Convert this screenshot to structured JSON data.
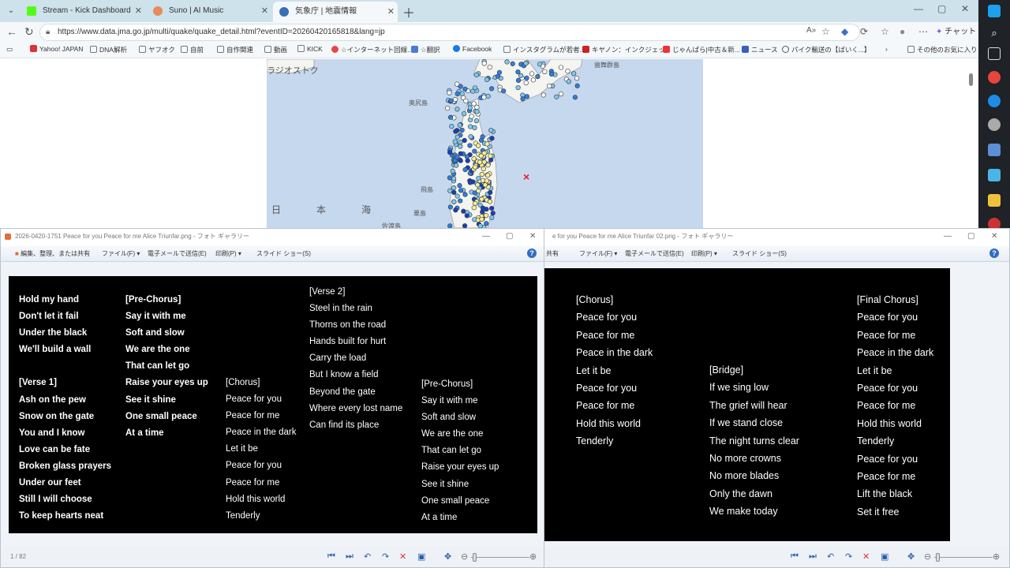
{
  "browser": {
    "tabs": [
      {
        "title": "Stream - Kick Dashboard",
        "color": "#53fc18"
      },
      {
        "title": "Suno | AI Music",
        "color": "#e88a5a"
      },
      {
        "title": "気象庁 | 地震情報",
        "color": "#3a6fb5"
      }
    ],
    "url": "https://www.data.jma.go.jp/multi/quake/quake_detail.html?eventID=20260420165818&lang=jp",
    "copilot_label": "チャット",
    "bookmarks": [
      "Yahoo! JAPAN",
      "DNA解析",
      "ヤフオク",
      "自前",
      "自作関連",
      "動画",
      "KICK",
      "☆インターネット回線...",
      "☆翻訳",
      "Facebook",
      "インスタグラムが若者...",
      "キヤノン：インクジェッ...",
      "じゃんぱら|中古＆新...",
      "ニュース",
      "パイク輸送の【ばいく...】"
    ],
    "other_favorites": "その他のお気に入り"
  },
  "map": {
    "labels": [
      "ラジオストク",
      "奥尻島",
      "飛島",
      "粟島",
      "佐渡島",
      "歯舞群島",
      "日",
      "本",
      "海"
    ],
    "epicenter_marker": "×"
  },
  "gallery_left": {
    "title": "2026-0420-1751 Peace for you Peace for me Alice Triunfar.png - フォト ギャラリー",
    "menu": [
      "編集、整理、または共有",
      "ファイル(F) ▾",
      "電子メールで送信(E)",
      "印刷(P) ▾",
      "スライド ショー(S)"
    ],
    "page_indicator": "1 / 82",
    "lyrics_col1": [
      "Hold my hand",
      "Don't let it fail",
      "Under the black",
      "We'll build a wall",
      "",
      "[Verse 1]",
      "Ash on the pew",
      "Snow on the gate",
      "You and I know",
      "Love can be fate",
      "Broken glass prayers",
      "Under our feet",
      "Still I will choose",
      "To keep hearts neat"
    ],
    "lyrics_col2": [
      "[Pre-Chorus]",
      "Say it with me",
      "Soft and slow",
      "We are the one",
      "That can let go",
      "Raise your eyes up",
      "See it shine",
      "One small peace",
      "At a time"
    ],
    "lyrics_col3": [
      "[Chorus]",
      "Peace for you",
      "Peace for me",
      "Peace in the dark",
      "Let it be",
      "Peace for you",
      "Peace for me",
      "Hold this world",
      "Tenderly"
    ],
    "lyrics_col4": [
      "[Verse 2]",
      "Steel in the rain",
      "Thorns on the road",
      "Hands built for hurt",
      "Carry the load",
      "But I know a field",
      "Beyond the gate",
      "Where every lost name",
      "Can find its place"
    ],
    "lyrics_col5": [
      "[Pre-Chorus]",
      "Say it with me",
      "Soft and slow",
      "We are the one",
      "That can let go",
      "Raise your eyes up",
      "See it shine",
      "One small peace",
      "At a time"
    ]
  },
  "gallery_right": {
    "title": "e for you Peace for me Alice Triunfar 02.png - フォト ギャラリー",
    "menu": [
      "共有",
      "ファイル(F) ▾",
      "電子メールで送信(E)",
      "印刷(P) ▾",
      "スライド ショー(S)"
    ],
    "lyrics_col1": [
      "[Chorus]",
      "Peace for you",
      "Peace for me",
      "Peace in the dark",
      "Let it be",
      "Peace for you",
      "Peace for me",
      "Hold this world",
      "Tenderly"
    ],
    "lyrics_col2": [
      "[Bridge]",
      "If we sing low",
      "The grief will hear",
      "If we stand close",
      "The night turns clear",
      "No more crowns",
      "No more blades",
      "Only the dawn",
      "We make today"
    ],
    "lyrics_col3": [
      "[Final Chorus]",
      "Peace for you",
      "Peace for me",
      "Peace in the dark",
      "Let it be",
      "Peace for you",
      "Peace for me",
      "Hold this world",
      "Tenderly",
      "Peace for you",
      "Peace for me",
      "Lift the black",
      "Set it free"
    ]
  }
}
